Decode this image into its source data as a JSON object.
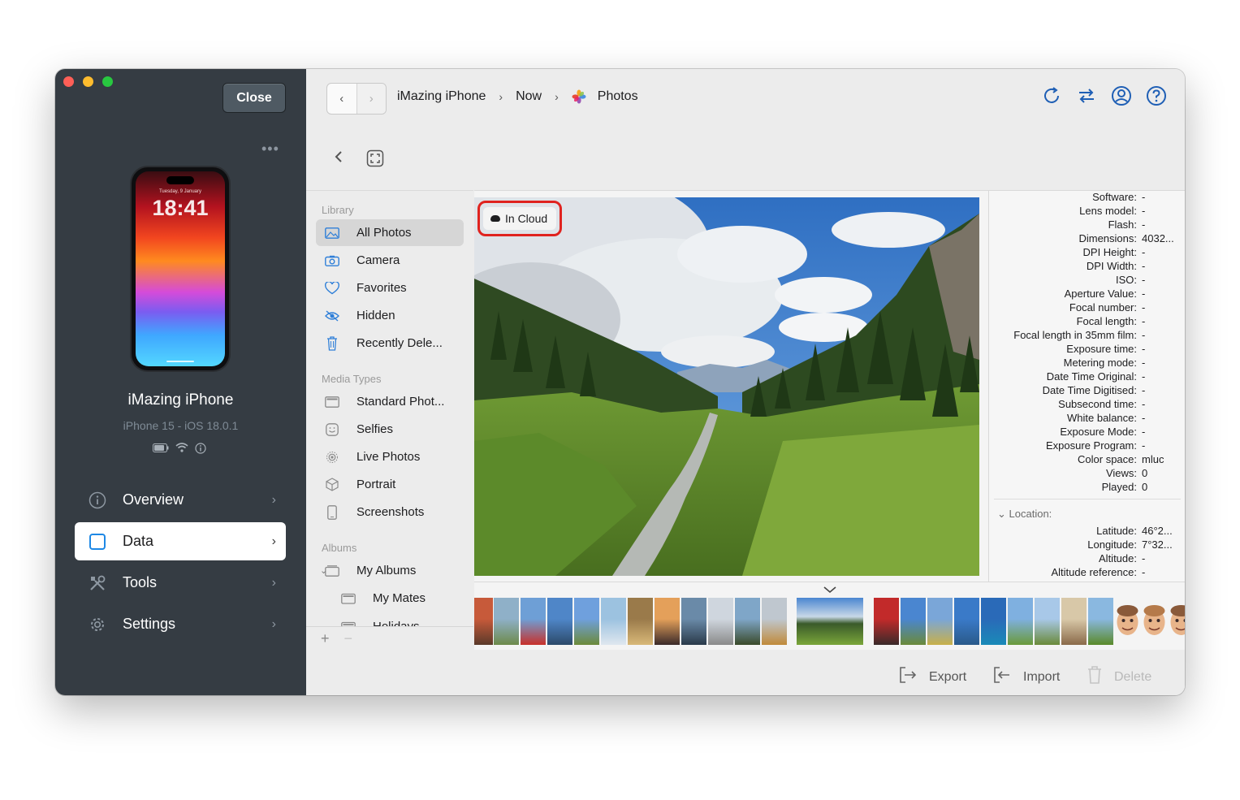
{
  "window": {
    "close_label": "Close",
    "more_label": "•••"
  },
  "device": {
    "lock_date": "Tuesday, 9 January",
    "lock_time": "18:41",
    "name": "iMazing iPhone",
    "subtitle": "iPhone 15 - iOS 18.0.1"
  },
  "sidebar": {
    "items": [
      {
        "label": "Overview",
        "icon": "info-circle-icon"
      },
      {
        "label": "Data",
        "icon": "square-icon",
        "active": true
      },
      {
        "label": "Tools",
        "icon": "tools-icon"
      },
      {
        "label": "Settings",
        "icon": "gear-icon"
      }
    ]
  },
  "breadcrumb": {
    "items": [
      "iMazing iPhone",
      "Now",
      "Photos"
    ]
  },
  "library": {
    "sections": [
      {
        "heading": "Library",
        "items": [
          "All Photos",
          "Camera",
          "Favorites",
          "Hidden",
          "Recently Dele..."
        ]
      },
      {
        "heading": "Media Types",
        "items": [
          "Standard Phot...",
          "Selfies",
          "Live Photos",
          "Portrait",
          "Screenshots"
        ]
      },
      {
        "heading": "Albums",
        "items": [
          "My Albums",
          "My Mates",
          "Holidays"
        ]
      }
    ],
    "footer": {
      "add": "+",
      "remove": "−"
    }
  },
  "photo": {
    "badge": "In Cloud"
  },
  "info": {
    "rows": [
      {
        "k": "Software:",
        "v": "-"
      },
      {
        "k": "Lens model:",
        "v": "-"
      },
      {
        "k": "Flash:",
        "v": "-"
      },
      {
        "k": "Dimensions:",
        "v": "4032..."
      },
      {
        "k": "DPI Height:",
        "v": "-"
      },
      {
        "k": "DPI Width:",
        "v": "-"
      },
      {
        "k": "ISO:",
        "v": "-"
      },
      {
        "k": "Aperture Value:",
        "v": "-"
      },
      {
        "k": "Focal number:",
        "v": "-"
      },
      {
        "k": "Focal length:",
        "v": "-"
      },
      {
        "k": "Focal length in 35mm film:",
        "v": "-"
      },
      {
        "k": "Exposure time:",
        "v": "-"
      },
      {
        "k": "Metering mode:",
        "v": "-"
      },
      {
        "k": "Date Time Original:",
        "v": "-"
      },
      {
        "k": "Date Time Digitised:",
        "v": "-"
      },
      {
        "k": "Subsecond time:",
        "v": "-"
      },
      {
        "k": "White balance:",
        "v": "-"
      },
      {
        "k": "Exposure Mode:",
        "v": "-"
      },
      {
        "k": "Exposure Program:",
        "v": "-"
      },
      {
        "k": "Color space:",
        "v": "mluc"
      },
      {
        "k": "Views:",
        "v": "0"
      },
      {
        "k": "Played:",
        "v": "0"
      }
    ],
    "location_heading": "Location:",
    "location_rows": [
      {
        "k": "Latitude:",
        "v": "46°2..."
      },
      {
        "k": "Longitude:",
        "v": "7°32..."
      },
      {
        "k": "Altitude:",
        "v": "-"
      },
      {
        "k": "Altitude reference:",
        "v": "-"
      }
    ]
  },
  "actions": {
    "export": "Export",
    "import": "Import",
    "delete": "Delete"
  }
}
